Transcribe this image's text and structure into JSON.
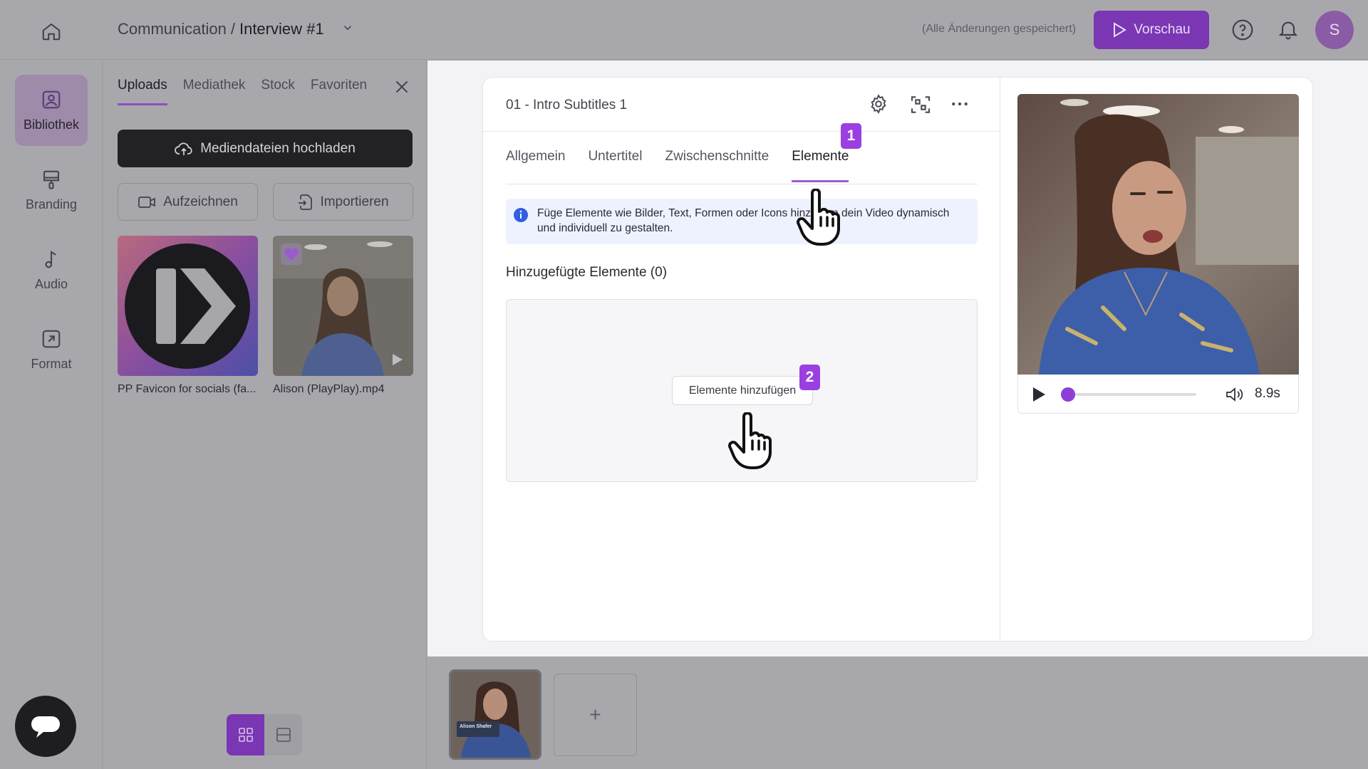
{
  "header": {
    "breadcrumb_parent": "Communication",
    "breadcrumb_separator": "/",
    "breadcrumb_current": "Interview #1",
    "saved_status": "(Alle Änderungen gespeichert)",
    "preview_label": "Vorschau",
    "avatar_initial": "S"
  },
  "rail": {
    "items": [
      {
        "label": "Bibliothek",
        "icon": "image-icon"
      },
      {
        "label": "Branding",
        "icon": "paint-roller-icon"
      },
      {
        "label": "Audio",
        "icon": "music-note-icon"
      },
      {
        "label": "Format",
        "icon": "resize-icon"
      }
    ]
  },
  "library": {
    "tabs": [
      "Uploads",
      "Mediathek",
      "Stock",
      "Favoriten"
    ],
    "upload_label": "Mediendateien hochladen",
    "record_label": "Aufzeichnen",
    "import_label": "Importieren",
    "media": [
      {
        "name": "PP Favicon for socials (fa..."
      },
      {
        "name": "Alison (PlayPlay).mp4"
      }
    ]
  },
  "editor": {
    "scene_title": "01 - Intro Subtitles 1",
    "tabs": [
      "Allgemein",
      "Untertitel",
      "Zwischenschnitte",
      "Elemente"
    ],
    "info_text": "Füge Elemente wie Bilder, Text, Formen oder Icons hinzu, um dein Video dynamisch und individuell zu gestalten.",
    "added_title": "Hinzugefügte Elemente (0)",
    "add_elements_label": "Elemente hinzufügen",
    "badge_1": "1",
    "badge_2": "2"
  },
  "player": {
    "time": "8.9s",
    "progress": 0.0
  },
  "timeline": {
    "add_label": "+",
    "scene_caption": "Alison Shafer"
  },
  "colors": {
    "accent": "#7a36b3",
    "badge": "#9b3fe0",
    "info_bg": "#eef2ff"
  }
}
